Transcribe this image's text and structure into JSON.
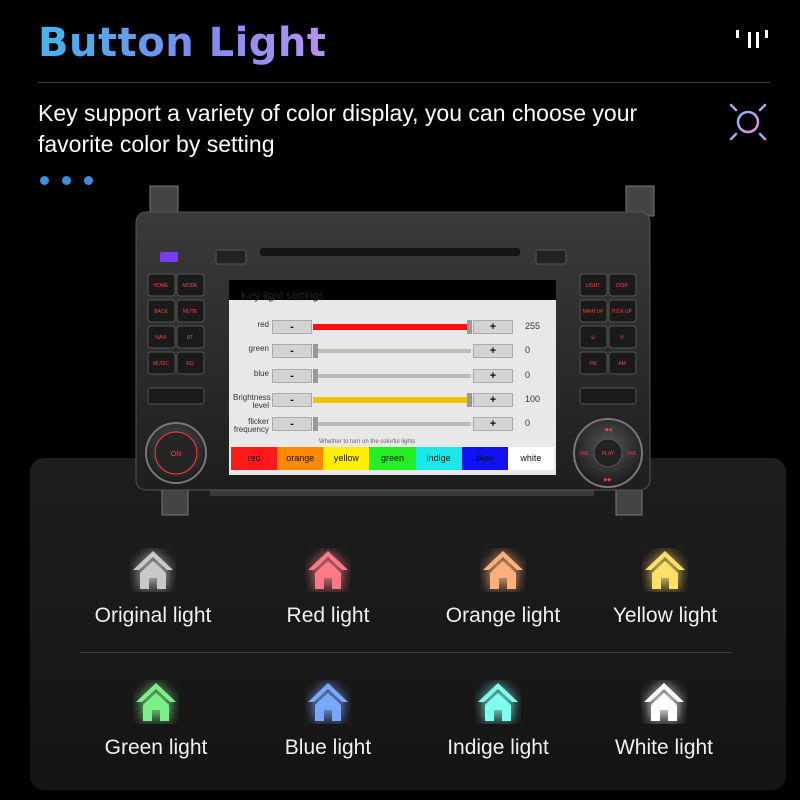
{
  "header": {
    "title": "Button Light",
    "subtitle": "Key support a variety of color display, you can choose your favorite color by setting"
  },
  "screen": {
    "title": "Key light settings",
    "rows": [
      {
        "name": "red",
        "value": "255",
        "fill": 1.0,
        "color": "#ff1010"
      },
      {
        "name": "green",
        "value": "0",
        "fill": 0.0,
        "color": "#888888"
      },
      {
        "name": "blue",
        "value": "0",
        "fill": 0.0,
        "color": "#888888"
      },
      {
        "name": "Brightness level",
        "value": "100",
        "fill": 1.0,
        "color": "#f2c200"
      },
      {
        "name": "flicker frequency",
        "value": "0",
        "fill": 0.0,
        "color": "#888888"
      }
    ],
    "minus": "-",
    "plus": "+",
    "note": "Whether to turn on the colorful lights",
    "colors": [
      {
        "label": "red",
        "bg": "#ff1a1a"
      },
      {
        "label": "orange",
        "bg": "#ff8a00"
      },
      {
        "label": "yellow",
        "bg": "#ffee00"
      },
      {
        "label": "green",
        "bg": "#22ee22"
      },
      {
        "label": "indige",
        "bg": "#18e8e8"
      },
      {
        "label": "blue",
        "bg": "#1010f0"
      },
      {
        "label": "white",
        "bg": "#ffffff"
      }
    ],
    "unit_buttons": {
      "left": [
        "HOME",
        "MODE",
        "BACK",
        "MUTE",
        "NAVI",
        "BT",
        "MUSIC",
        "EQ"
      ],
      "right": [
        "LIGHT",
        "DISP",
        "MAIN UP",
        "PICK UP",
        "FM",
        "AM"
      ],
      "knob_left": "ON",
      "knob_right": [
        "VOL",
        "PLAY",
        "VOL"
      ]
    }
  },
  "lights": [
    {
      "label": "Original light",
      "color": "#c8c8c8"
    },
    {
      "label": "Red light",
      "color": "#ff7a86"
    },
    {
      "label": "Orange light",
      "color": "#ffb07a"
    },
    {
      "label": "Yellow light",
      "color": "#ffe06a"
    },
    {
      "label": "Green light",
      "color": "#7ef08a"
    },
    {
      "label": "Blue light",
      "color": "#7aa8ff"
    },
    {
      "label": "Indige light",
      "color": "#80fff0"
    },
    {
      "label": "White light",
      "color": "#ffffff"
    }
  ],
  "colors": {
    "accent": "#3e8ee0",
    "title_start": "#44b4f0",
    "title_end": "#b792f2"
  }
}
